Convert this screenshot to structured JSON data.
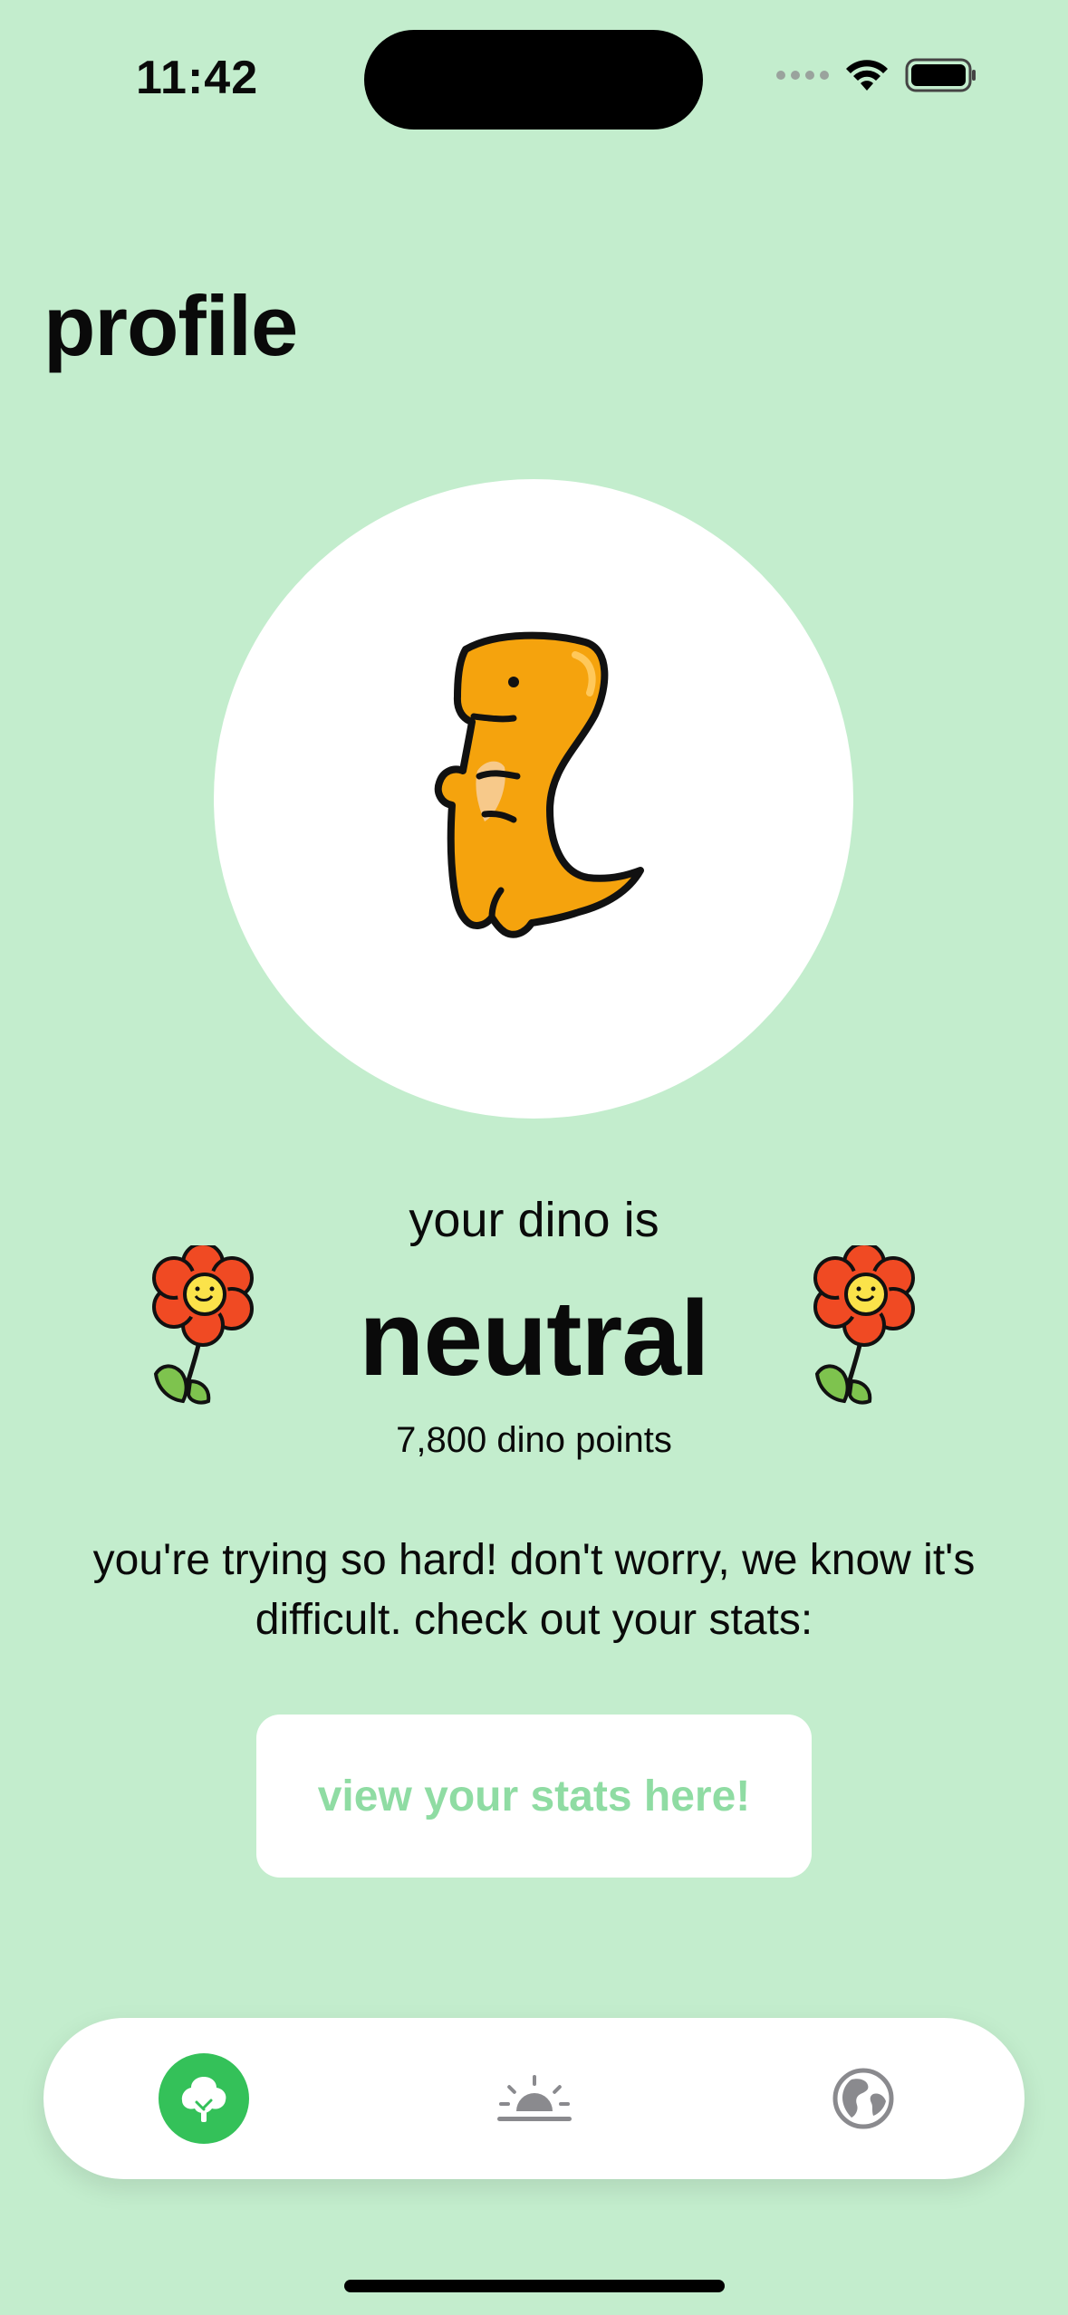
{
  "status_bar": {
    "time": "11:42"
  },
  "page_title": "profile",
  "dino": {
    "status_label": "your dino is",
    "mood": "neutral",
    "points": "7,800 dino points",
    "color": "#f5a30d"
  },
  "message": "you're trying so hard! don't worry, we know it's difficult. check out your stats:",
  "stats_button": {
    "label": "view your stats here!"
  },
  "tab_bar": {
    "tabs": [
      {
        "icon": "tree-icon",
        "active": true
      },
      {
        "icon": "sunrise-icon",
        "active": false
      },
      {
        "icon": "globe-icon",
        "active": false
      }
    ]
  },
  "colors": {
    "background": "#c3edcd",
    "accent": "#34c159",
    "button_text": "#8fdca3"
  }
}
